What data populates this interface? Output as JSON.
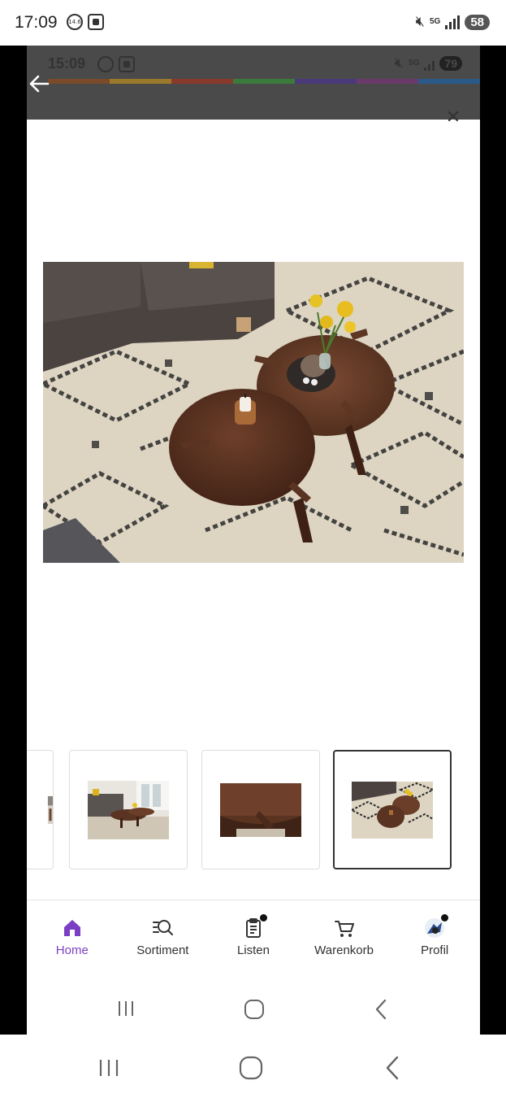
{
  "status_bar": {
    "time": "17:09",
    "left_icon_1": "14.6",
    "battery": "58",
    "network": "5G"
  },
  "inner_status_bar": {
    "time": "15:09",
    "battery": "79",
    "network": "5G"
  },
  "thumbnails": [
    {
      "name": "thumb-partial",
      "selected": false
    },
    {
      "name": "thumb-living-room",
      "selected": false
    },
    {
      "name": "thumb-table-closeup",
      "selected": false
    },
    {
      "name": "thumb-top-view",
      "selected": true
    }
  ],
  "bottom_nav": {
    "items": [
      {
        "label": "Home",
        "icon": "home-icon",
        "active": true
      },
      {
        "label": "Sortiment",
        "icon": "search-list-icon",
        "active": false
      },
      {
        "label": "Listen",
        "icon": "clipboard-icon",
        "active": false,
        "badge": true
      },
      {
        "label": "Warenkorb",
        "icon": "cart-icon",
        "active": false
      },
      {
        "label": "Profil",
        "icon": "profile-avatar-icon",
        "active": false,
        "badge": true
      }
    ]
  },
  "colors": {
    "accent": "#7b3fc4",
    "inner_header": "#4a4a4a",
    "rainbow": [
      "#7a4a2a",
      "#9a7a2a",
      "#8a3a2a",
      "#3a7a3a",
      "#4a3a7a",
      "#6a3a6a",
      "#2a5a8a"
    ]
  }
}
